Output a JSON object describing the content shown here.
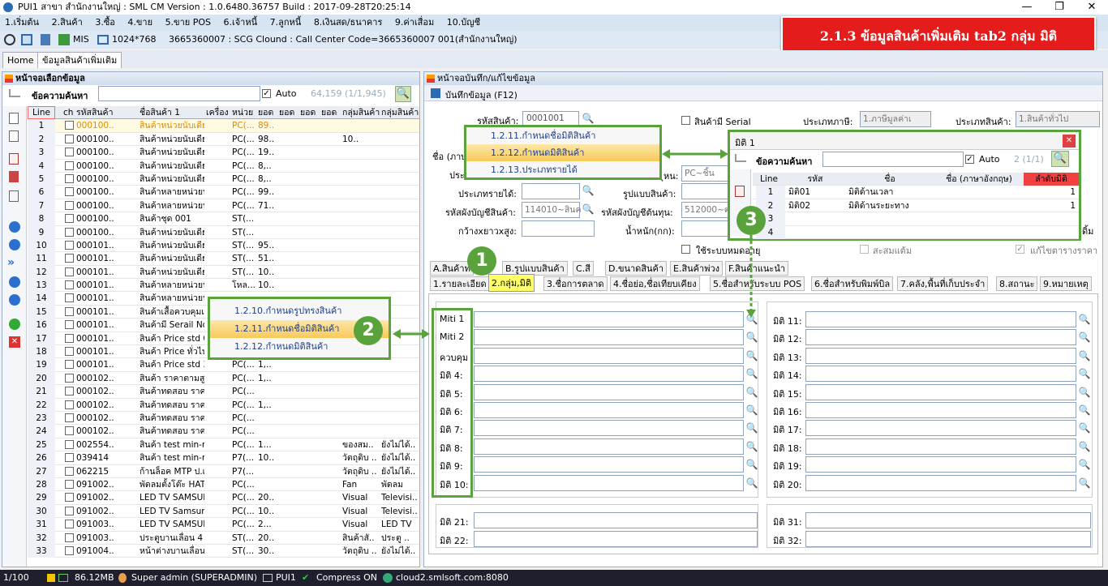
{
  "window": {
    "title": "PUI1 สาขา สำนักงานใหญ่ : SML CM Version : 1.0.6480.36757  Build : 2017-09-28T20:25:14",
    "min_icon": "minimize-icon",
    "max_icon": "maximize-icon",
    "close_icon": "close-icon"
  },
  "menu": [
    "1.เริ่มต้น",
    "2.สินค้า",
    "3.ซื้อ",
    "4.ขาย",
    "5.ขาย POS",
    "6.เจ้าหนี้",
    "7.ลูกหนี้",
    "8.เงินสด/ธนาคาร",
    "9.ค่าเสื่อม",
    "10.บัญชี"
  ],
  "toolbar": {
    "mis": "MIS",
    "resolution": "1024*768",
    "info": "3665360007 : SCG Clound : Call Center Code=3665360007 001(สำนักงานใหญ่)"
  },
  "banner": "2.1.3 ข้อมูลสินค้าเพิ่มเติม tab2 กลุ่ม มิติ",
  "tabs": {
    "home": "Home",
    "product": "ข้อมูลสินค้าเพิ่มเติม"
  },
  "left": {
    "title": "หน้าจอเลือกข้อมูล",
    "search_label": "ข้อความค้นหา",
    "auto": "Auto",
    "count": "64,159 (1/1,945)",
    "columns": [
      "Line",
      "ch",
      "รหัสสินค้า",
      "ชื่อสินค้า 1",
      "เครื่อง",
      "หน่วย",
      "ยอด",
      "ยอด",
      "ยอด",
      "ยอด",
      "กลุ่มสินค้า",
      "กลุ่มสินค้า"
    ],
    "rows": [
      {
        "n": "1",
        "code": "000100..",
        "name": "สินค้าหน่วยนับเดียว ..",
        "unit": "PC(...",
        "qty": "89..",
        "g1": "",
        "g2": ""
      },
      {
        "n": "2",
        "code": "000100..",
        "name": "สินค้าหน่วยนับเดียว ..",
        "unit": "PC(...",
        "qty": "98..",
        "g1": "10..",
        "g2": ""
      },
      {
        "n": "3",
        "code": "000100..",
        "name": "สินค้าหน่วยนับเดียว ..",
        "unit": "PC(...",
        "qty": "19..",
        "g1": "",
        "g2": ""
      },
      {
        "n": "4",
        "code": "000100..",
        "name": "สินค้าหน่วยนับเดียว ..",
        "unit": "PC(...",
        "qty": "8,..",
        "g1": "",
        "g2": ""
      },
      {
        "n": "5",
        "code": "000100..",
        "name": "สินค้าหน่วยนับเดียว ..",
        "unit": "PC(...",
        "qty": "8,..",
        "g1": "",
        "g2": ""
      },
      {
        "n": "6",
        "code": "000100..",
        "name": "สินค้าหลายหน่วยนั..",
        "unit": "PC(...",
        "qty": "99..",
        "g1": "",
        "g2": ""
      },
      {
        "n": "7",
        "code": "000100..",
        "name": "สินค้าหลายหน่วยนั..",
        "unit": "PC(...",
        "qty": "71..",
        "g1": "",
        "g2": ""
      },
      {
        "n": "8",
        "code": "000100..",
        "name": "สินค้าชุด 001",
        "unit": "ST(...",
        "qty": "",
        "g1": "",
        "g2": ""
      },
      {
        "n": "9",
        "code": "000100..",
        "name": "สินค้าหน่วยนับเดียว ..",
        "unit": "ST(...",
        "qty": "",
        "g1": "",
        "g2": ""
      },
      {
        "n": "10",
        "code": "000101..",
        "name": "สินค้าหน่วยนับเดียว ..",
        "unit": "ST(...",
        "qty": "95..",
        "g1": "",
        "g2": ""
      },
      {
        "n": "11",
        "code": "000101..",
        "name": "สินค้าหน่วยนับเดียว ..",
        "unit": "ST(...",
        "qty": "51..",
        "g1": "",
        "g2": ""
      },
      {
        "n": "12",
        "code": "000101..",
        "name": "สินค้าหน่วยนับเดียว ..",
        "unit": "ST(...",
        "qty": "10..",
        "g1": "",
        "g2": ""
      },
      {
        "n": "13",
        "code": "000101..",
        "name": "สินค้าหลายหน่วยนั..",
        "unit": "โหล...",
        "qty": "10..",
        "g1": "",
        "g2": ""
      },
      {
        "n": "14",
        "code": "000101..",
        "name": "สินค้าหลายหน่วยนั..",
        "unit": "",
        "qty": "",
        "g1": "",
        "g2": ""
      },
      {
        "n": "15",
        "code": "000101..",
        "name": "สินค้าเสื้อควบคุมเฉ..",
        "unit": "",
        "qty": "",
        "g1": "",
        "g2": ""
      },
      {
        "n": "16",
        "code": "000101..",
        "name": "สินค้ามี Serail No -..",
        "unit": "",
        "qty": "",
        "g1": "",
        "g2": ""
      },
      {
        "n": "17",
        "code": "000101..",
        "name": "สินค้า Price std 001",
        "unit": "",
        "qty": "",
        "g1": "",
        "g2": ""
      },
      {
        "n": "18",
        "code": "000101..",
        "name": "สินค้า Price ทั่วไป ..",
        "unit": "",
        "qty": "",
        "g1": "",
        "g2": ""
      },
      {
        "n": "19",
        "code": "000101..",
        "name": "สินค้า Price std 3 S..",
        "unit": "PC(...",
        "qty": "1,..",
        "g1": "",
        "g2": ""
      },
      {
        "n": "20",
        "code": "000102..",
        "name": "สินค้า ราคาตามสูตร",
        "unit": "PC(...",
        "qty": "1,..",
        "g1": "",
        "g2": ""
      },
      {
        "n": "21",
        "code": "000102..",
        "name": "สินค้าทดสอบ ราคา..",
        "unit": "PC(...",
        "qty": "",
        "g1": "",
        "g2": ""
      },
      {
        "n": "22",
        "code": "000102..",
        "name": "สินค้าทดสอบ ราคา..",
        "unit": "PC(...",
        "qty": "1,..",
        "g1": "",
        "g2": ""
      },
      {
        "n": "23",
        "code": "000102..",
        "name": "สินค้าทดสอบ ราคา..",
        "unit": "PC(...",
        "qty": "",
        "g1": "",
        "g2": ""
      },
      {
        "n": "24",
        "code": "000102..",
        "name": "สินค้าทดสอบ ราคา..",
        "unit": "PC(...",
        "qty": "",
        "g1": "",
        "g2": ""
      },
      {
        "n": "25",
        "code": "002554..",
        "name": "สินค้า test min-ma..",
        "unit": "PC(...",
        "qty": "1...",
        "g1": "ของสม..",
        "g2": "ยังไม่ได้.."
      },
      {
        "n": "26",
        "code": "039414",
        "name": "สินค้า test min-ma..",
        "unit": "P7(...",
        "qty": "10..",
        "g1": "วัตถุดิบ ..",
        "g2": "ยังไม่ได้.."
      },
      {
        "n": "27",
        "code": "062215",
        "name": "ก้านล็อค MTP ป.เล็..",
        "unit": "P7(...",
        "qty": "",
        "g1": "วัตถุดิบ ..",
        "g2": "ยังไม่ได้.."
      },
      {
        "n": "28",
        "code": "091002..",
        "name": "พัดลมตั้งโต๊ะ HATA..",
        "unit": "PC(...",
        "qty": "",
        "g1": "Fan",
        "g2": "พัดลม"
      },
      {
        "n": "29",
        "code": "091002..",
        "name": "LED TV SAMSUNG ..",
        "unit": "PC(...",
        "qty": "20..",
        "g1": "Visual",
        "g2": "Televisi.."
      },
      {
        "n": "30",
        "code": "091002..",
        "name": "LED TV Samsung(..",
        "unit": "PC(...",
        "qty": "10..",
        "g1": "Visual",
        "g2": "Televisi.."
      },
      {
        "n": "31",
        "code": "091003..",
        "name": "LED TV SAMSUNG..",
        "unit": "PC(...",
        "qty": "2...",
        "g1": "Visual",
        "g2": "LED TV"
      },
      {
        "n": "32",
        "code": "091003..",
        "name": "ประตูบานเลื่อน 4 บ..",
        "unit": "ST(...",
        "qty": "20..",
        "g1": "สินค้าสั..",
        "g2": "ประตู .."
      },
      {
        "n": "33",
        "code": "091004..",
        "name": "หน้าต่างบานเลื่อนส..",
        "unit": "ST(...",
        "qty": "30..",
        "g1": "วัตถุดิบ ..",
        "g2": "ยังไม่ได้.."
      }
    ]
  },
  "right": {
    "title": "หน้าจอบันทึก/แก้ไขข้อมูล",
    "save": "บันทึกข้อมูล (F12)",
    "code_label": "รหัสสินค้า:",
    "code_value": "0001001",
    "serial": "สินค้ามี Serial",
    "tax_label": "ประเภทภาษี:",
    "tax_value": "1.ภาษีมูลค่าเ",
    "type_label": "ประเภทสินค้า:",
    "type_value": "1.สินค้าทั่วไป",
    "name_label": "ชื่อ (ภาษ",
    "prev_label": "ประ",
    "unit_label": "ุหน:",
    "unit_value": "PC~ชิ้น",
    "income_label": "ประเภทรายได้:",
    "form_label": "รูปแบบสินค้า:",
    "acc_label": "รหัสผังบัญชีสินค้า:",
    "acc_value": "114010~สินค",
    "cost_label": "รหัสผังบัญชีต้นทุน:",
    "cost_value": "512000~ต",
    "size_label": "กว้างxยาวxสูง:",
    "weight_label": "น้ำหนัก(กก):",
    "fullcol_label": "ใช้ระบบหมดอายุ",
    "accum": "สะสมแต้ม",
    "editprice": "แก้ไขตารางราคา",
    "extra_label": "ดิ้ม",
    "tabs_top": [
      "A.สินค้าท",
      "B.รูปแบบสินค้า",
      "C.สี",
      "D.ขนาดสินค้า",
      "E.สินค้าพ่วง",
      "F.สินค้าแนะนำ"
    ],
    "tabs_bottom": [
      "1.รายละเอียด",
      "2.กลุ่ม,มิติ",
      "3.ชื่อการตลาด",
      "4.ชื่อย่อ,ชื่อเทียบเคียง",
      "5.ชื่อสำหรับระบบ POS",
      "6.ชื่อสำหรับพิมพ์บิล",
      "7.คลัง,พื้นที่เก็บประจำ",
      "8.สถานะ",
      "9.หมายเหตุ"
    ],
    "left_fields": [
      "Miti 1",
      "Miti 2",
      "ควบคุม",
      "มิติ 4:",
      "มิติ 5:",
      "มิติ 6:",
      "มิติ 7:",
      "มิติ 8:",
      "มิติ 9:",
      "มิติ 10:"
    ],
    "right_fields": [
      "มิติ 11:",
      "มิติ 12:",
      "มิติ 13:",
      "มิติ 14:",
      "มิติ 15:",
      "มิติ 16:",
      "มิติ 17:",
      "มิติ 18:",
      "มิติ 19:",
      "มิติ 20:"
    ],
    "bottom_left": [
      "มิติ 21:",
      "มิติ 22:"
    ],
    "bottom_right": [
      "มิติ 31:",
      "มิติ 32:"
    ]
  },
  "popup_menu1": [
    "1.2.11.กำหนดชื่อมิติสินค้า",
    "1.2.12.กำหนดมิติสินค้า",
    "1.2.13.ประเภทรายได้"
  ],
  "popup_menu2": [
    "1.2.10.กำหนดรูปทรงสินค้า",
    "1.2.11.กำหนดชื่อมิติสินค้า",
    "1.2.12.กำหนดมิติสินค้า"
  ],
  "dialog": {
    "title": "มิติ 1",
    "search_label": "ข้อความค้นหา",
    "auto": "Auto",
    "count": "2 (1/1)",
    "columns": [
      "Line",
      "รหัส",
      "ชื่อ",
      "ชื่อ (ภาษาอังกฤษ)",
      "ลำดับมิติ"
    ],
    "rows": [
      {
        "n": "1",
        "code": "มิติ01",
        "name": "มิติด้านเวลา",
        "en": "",
        "order": "1"
      },
      {
        "n": "2",
        "code": "มิติ02",
        "name": "มิติด้านระยะทาง",
        "en": "",
        "order": "1"
      },
      {
        "n": "3",
        "code": "",
        "name": "",
        "en": "",
        "order": ""
      },
      {
        "n": "4",
        "code": "",
        "name": "",
        "en": "",
        "order": ""
      }
    ]
  },
  "markers": [
    "1",
    "2",
    "3"
  ],
  "status": {
    "page": "1/100",
    "mem": "86.12MB",
    "user": "Super admin (SUPERADMIN)",
    "branch": "PUI1",
    "compress": "Compress ON",
    "server": "cloud2.smlsoft.com:8080"
  }
}
